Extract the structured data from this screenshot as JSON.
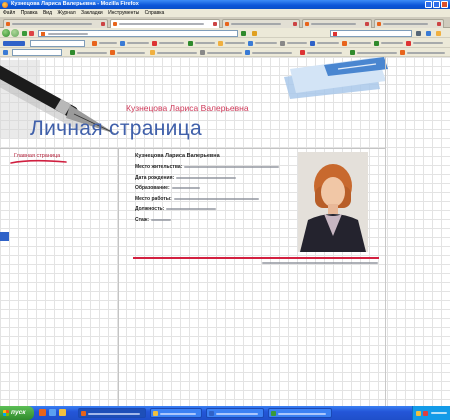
{
  "window": {
    "title": "Кузнецова Лариса Валерьевна - Mozilla Firefox"
  },
  "menu": {
    "items": [
      "Файл",
      "Правка",
      "Вид",
      "Журнал",
      "Закладки",
      "Инструменты",
      "Справка"
    ]
  },
  "page": {
    "owner_name": "Кузнецова Лариса Валерьевна",
    "heading": "Личная страница",
    "nav": {
      "home_label": "Главная страница"
    },
    "profile": {
      "name": "Кузнецова Лариса Валерьевна",
      "fields": [
        {
          "label": "Место жительства:"
        },
        {
          "label": "Дата рождения:"
        },
        {
          "label": "Образование:"
        },
        {
          "label": "Место работы:"
        },
        {
          "label": "Должность:"
        },
        {
          "label": "Стаж:"
        }
      ]
    }
  },
  "taskbar": {
    "start_label": "пуск"
  },
  "colors": {
    "xp_blue": "#245edb",
    "accent_red": "#d32040",
    "name_pink": "#cf3a5a",
    "heading_blue": "#4060aa",
    "start_green": "#2f8a2c"
  }
}
